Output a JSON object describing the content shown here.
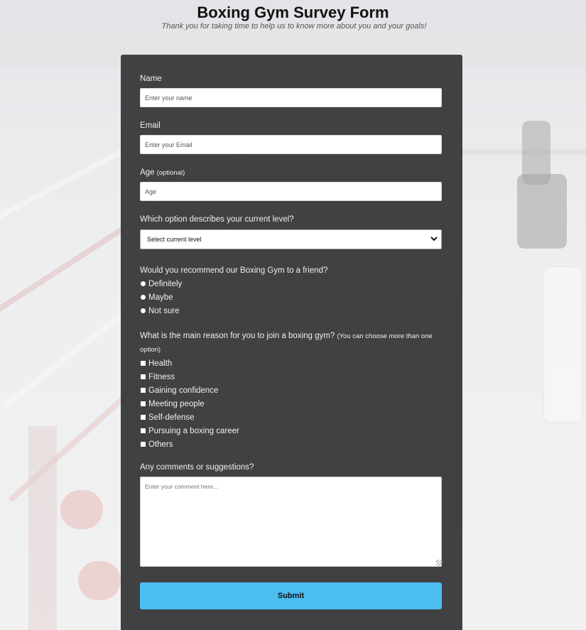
{
  "header": {
    "title": "Boxing Gym Survey Form",
    "subtitle": "Thank you for taking time to help us to know more about you and your goals!"
  },
  "form": {
    "name": {
      "label": "Name",
      "placeholder": "Enter your name"
    },
    "email": {
      "label": "Email",
      "placeholder": "Enter your Email"
    },
    "age": {
      "label": "Age",
      "note": "(optional)",
      "placeholder": "Age"
    },
    "level": {
      "label": "Which option describes your current level?",
      "selected": "Select current level"
    },
    "recommend": {
      "label": "Would you recommend our Boxing Gym to a friend?",
      "options": [
        "Definitely",
        "Maybe",
        "Not sure"
      ]
    },
    "reason": {
      "label": "What is the main reason for you to join a boxing gym?",
      "note": "(You can choose more than one option)",
      "options": [
        "Health",
        "Fitness",
        "Gaining confidence",
        "Meeting people",
        "Self-defense",
        "Pursuing a boxing career",
        "Others"
      ]
    },
    "comments": {
      "label": "Any comments or suggestions?",
      "placeholder": "Enter your comment here..."
    },
    "submit_label": "Submit"
  },
  "colors": {
    "card": "#3a3b3d",
    "submit": "#4cbdf0"
  },
  "icons": {
    "select_arrow": "chevron-down-icon",
    "textarea_resize": "resize-grip-icon"
  }
}
